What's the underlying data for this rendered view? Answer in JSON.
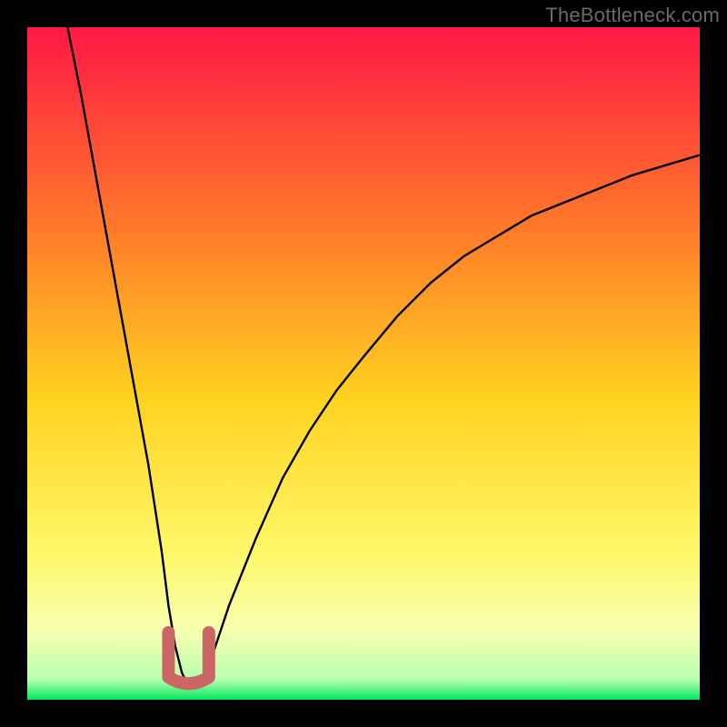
{
  "watermark": "TheBottleneck.com",
  "colors": {
    "gradient_top": "#ff1846",
    "gradient_mid_upper": "#ff7a2a",
    "gradient_mid": "#ffd21f",
    "gradient_mid_lower": "#fff86a",
    "gradient_lower": "#f6ffb0",
    "gradient_green": "#00e859",
    "curve": "#000000",
    "overlay": "#cc6666",
    "frame": "#000000"
  },
  "chart_data": {
    "type": "line",
    "title": "",
    "xlabel": "",
    "ylabel": "",
    "xlim": [
      0,
      100
    ],
    "ylim": [
      0,
      100
    ],
    "series": [
      {
        "name": "bottleneck-curve",
        "x": [
          6,
          8,
          10,
          12,
          14,
          16,
          18,
          20,
          21,
          22,
          23,
          24,
          25,
          26,
          27,
          28,
          30,
          34,
          38,
          42,
          46,
          50,
          55,
          60,
          65,
          70,
          75,
          80,
          85,
          90,
          95,
          100
        ],
        "values": [
          100,
          90,
          79,
          68,
          57,
          46,
          35,
          22,
          14,
          8,
          4,
          2,
          2,
          3,
          5,
          8,
          14,
          24,
          33,
          40,
          46,
          51,
          57,
          62,
          66,
          69,
          72,
          74,
          76,
          78,
          79.5,
          81
        ]
      }
    ],
    "annotations": [
      {
        "name": "min-overlay",
        "type": "u-shape",
        "x_center": 24,
        "y_bottom": 2,
        "width": 6,
        "height": 8,
        "color": "#cc6666"
      }
    ]
  }
}
